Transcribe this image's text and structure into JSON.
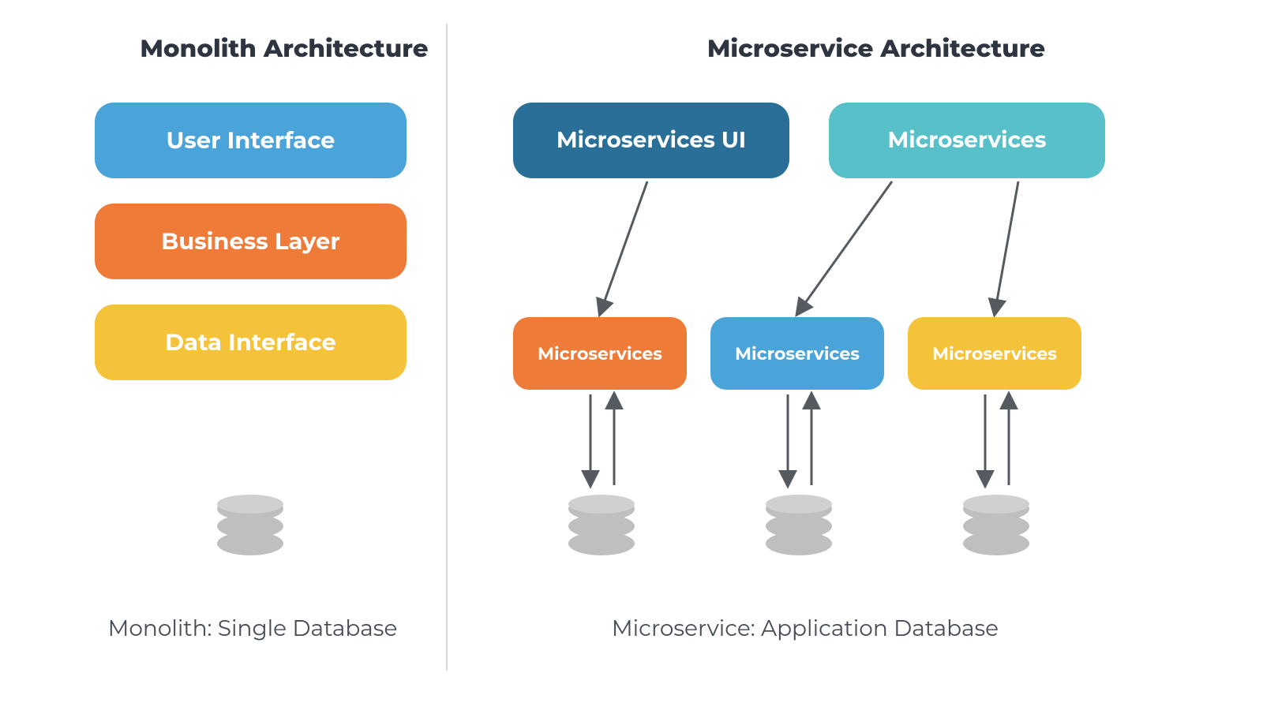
{
  "left": {
    "title": "Monolith Architecture",
    "layers": {
      "ui": "User Interface",
      "biz": "Business Layer",
      "data": "Data Interface"
    },
    "caption": "Monolith: Single Database"
  },
  "right": {
    "title": "Microservice Architecture",
    "top": {
      "ui": "Microservices UI",
      "group": "Microservices"
    },
    "services": {
      "s1": "Microservices",
      "s2": "Microservices",
      "s3": "Microservices"
    },
    "caption": "Microservice: Application Database"
  },
  "colors": {
    "blue": "#4aa4d9",
    "orange": "#ef7b39",
    "yellow": "#f4c33a",
    "darkblue": "#2a6f97",
    "teal": "#58c0c8",
    "arrow": "#555a60",
    "db": "#bfbfbf"
  }
}
